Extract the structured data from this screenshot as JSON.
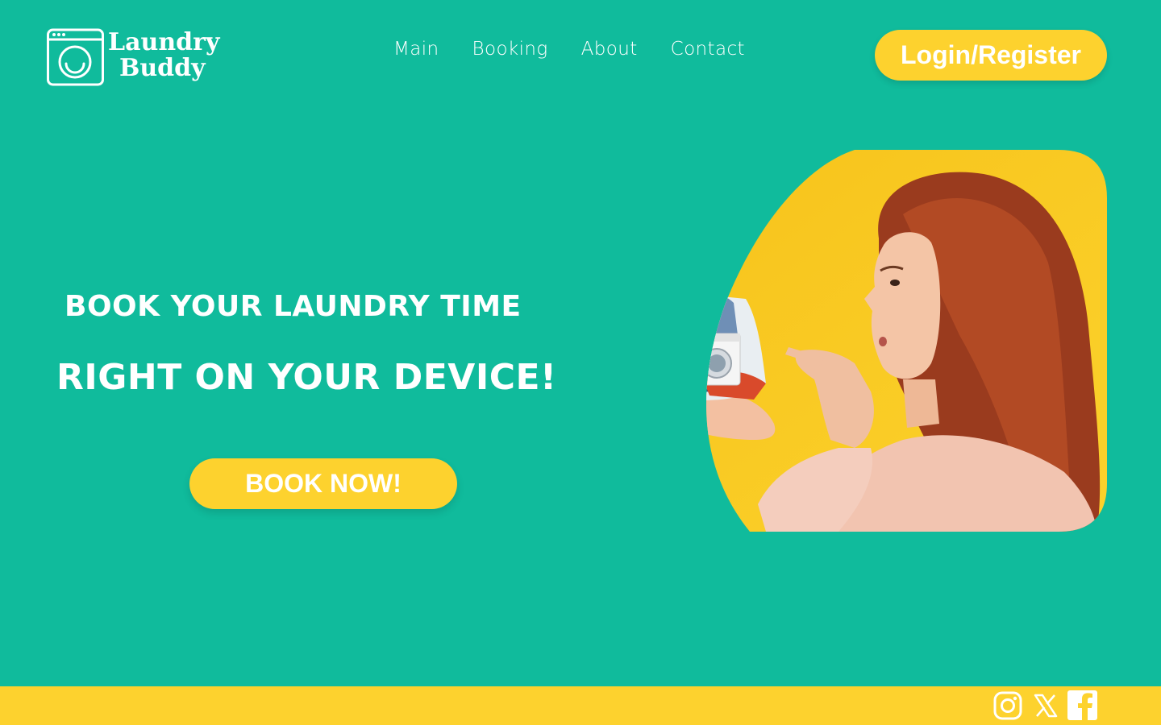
{
  "brand": {
    "line1": "Laundry",
    "line2": "Buddy",
    "logo_icon": "washing-machine-icon"
  },
  "nav": {
    "items": [
      {
        "label": "Main"
      },
      {
        "label": "Booking"
      },
      {
        "label": "About"
      },
      {
        "label": "Contact"
      }
    ]
  },
  "header": {
    "login_label": "Login/Register"
  },
  "hero": {
    "line1": "BOOK YOUR LAUNDRY TIME",
    "line2": "RIGHT ON YOUR DEVICE!",
    "cta_label": "BOOK NOW!"
  },
  "footer": {
    "social": [
      "instagram-icon",
      "x-icon",
      "facebook-icon"
    ]
  },
  "colors": {
    "background": "#10bb9c",
    "accent": "#fdd22e",
    "text": "#ffffff"
  }
}
